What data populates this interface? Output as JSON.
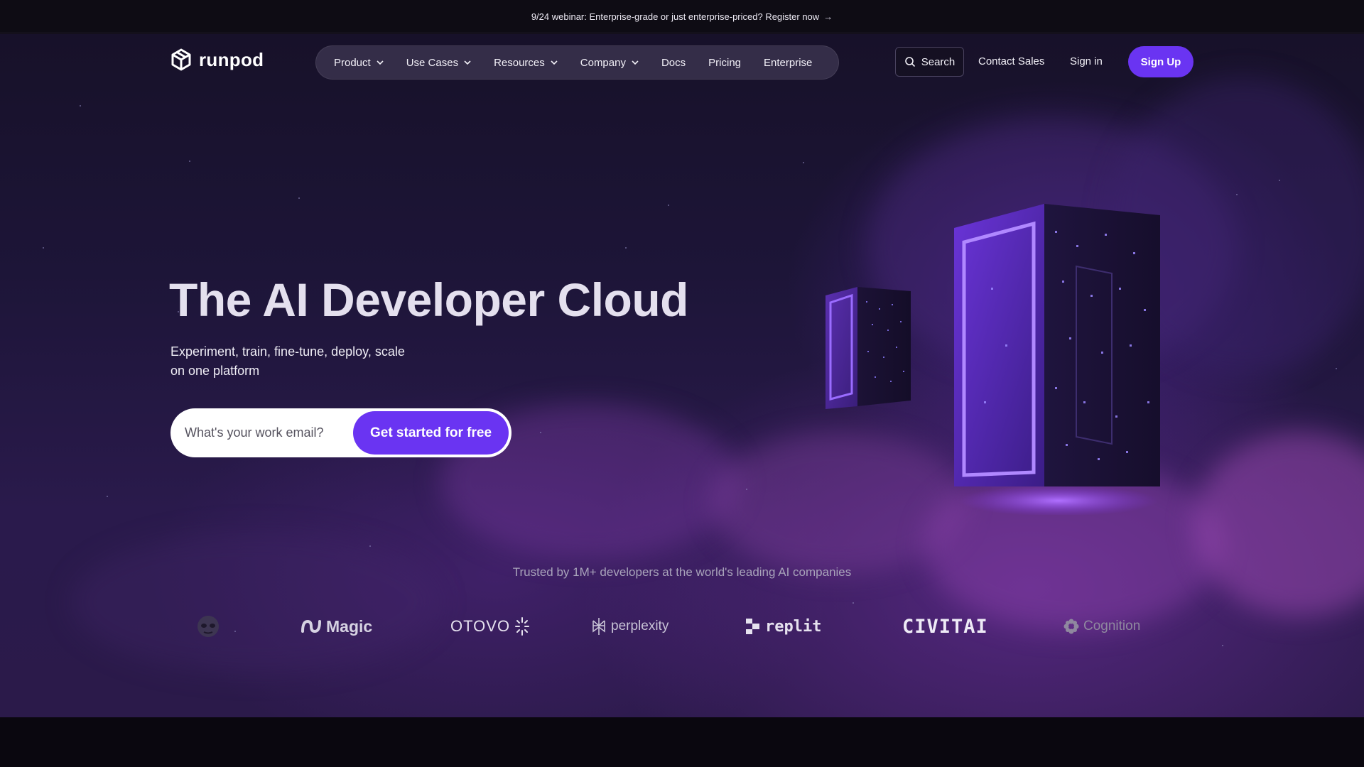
{
  "announcement": {
    "text": "9/24 webinar: Enterprise-grade or just enterprise-priced? Register now",
    "arrow": "→"
  },
  "brand": {
    "name": "runpod",
    "logo_icon": "runpod-cube-icon"
  },
  "nav": {
    "items": [
      {
        "label": "Product",
        "dropdown": true
      },
      {
        "label": "Use Cases",
        "dropdown": true
      },
      {
        "label": "Resources",
        "dropdown": true
      },
      {
        "label": "Company",
        "dropdown": true
      },
      {
        "label": "Docs",
        "dropdown": false
      },
      {
        "label": "Pricing",
        "dropdown": false
      },
      {
        "label": "Enterprise",
        "dropdown": false
      }
    ],
    "search_label": "Search",
    "contact_sales": "Contact Sales",
    "sign_in": "Sign in",
    "sign_up": "Sign Up"
  },
  "hero": {
    "title": "The AI Developer Cloud",
    "subtitle_line1": "Experiment, train, fine-tune, deploy, scale",
    "subtitle_line2": "on one platform",
    "email_placeholder": "What's your work email?",
    "cta_label": "Get started for free"
  },
  "trusted": {
    "text": "Trusted by 1M+ developers at the world's leading AI companies",
    "logos": [
      "Magic",
      "OTOVO",
      "perplexity",
      "replit",
      "CIVITAI",
      "Cognition"
    ]
  },
  "colors": {
    "accent": "#6a34f2",
    "background": "#1d1538",
    "announcement_bg": "#0e0c14"
  }
}
